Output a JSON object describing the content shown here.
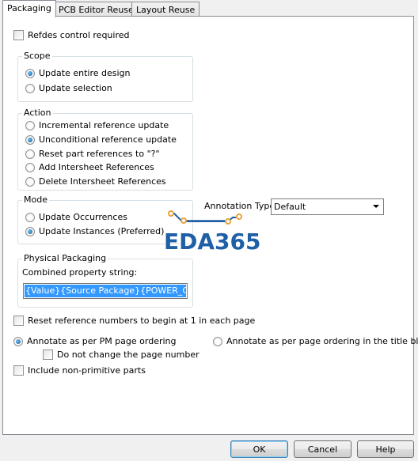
{
  "tabs": [
    {
      "label": "Packaging",
      "active": true
    },
    {
      "label": "PCB Editor Reuse",
      "active": false
    },
    {
      "label": "Layout Reuse",
      "active": false
    }
  ],
  "refdes": {
    "label": "Refdes control required",
    "checked": false
  },
  "scope": {
    "title": "Scope",
    "options": [
      {
        "label": "Update entire design",
        "selected": true
      },
      {
        "label": "Update selection",
        "selected": false
      }
    ]
  },
  "action": {
    "title": "Action",
    "options": [
      {
        "label": "Incremental reference update",
        "selected": false
      },
      {
        "label": "Unconditional reference update",
        "selected": true
      },
      {
        "label": "Reset part references to \"?\"",
        "selected": false
      },
      {
        "label": "Add Intersheet References",
        "selected": false
      },
      {
        "label": "Delete Intersheet References",
        "selected": false
      }
    ]
  },
  "mode": {
    "title": "Mode",
    "options": [
      {
        "label": "Update Occurrences",
        "selected": false
      },
      {
        "label": "Update Instances (Preferred)",
        "selected": true
      }
    ]
  },
  "annotation_type": {
    "label": "Annotation Type",
    "value": "Default"
  },
  "physical_packaging": {
    "title": "Physical Packaging",
    "combined_label": "Combined property string:",
    "combined_value": "{Value}{Source Package}{POWER_GROU"
  },
  "reset_numbers": {
    "label": "Reset reference numbers to begin at 1 in each page",
    "checked": false
  },
  "annotate_pm": {
    "label": "Annotate as per PM page ordering",
    "selected": true
  },
  "annotate_title": {
    "label": "Annotate as per page ordering in the title blocks",
    "selected": false
  },
  "no_change_page": {
    "label": "Do not change the page number",
    "checked": false
  },
  "non_primitive": {
    "label": "Include non-primitive parts",
    "checked": false
  },
  "watermark": {
    "text": "EDA365",
    "color": "#1f5fa6",
    "accent": "#e8a23a"
  },
  "buttons": {
    "ok": "OK",
    "cancel": "Cancel",
    "help": "Help"
  }
}
